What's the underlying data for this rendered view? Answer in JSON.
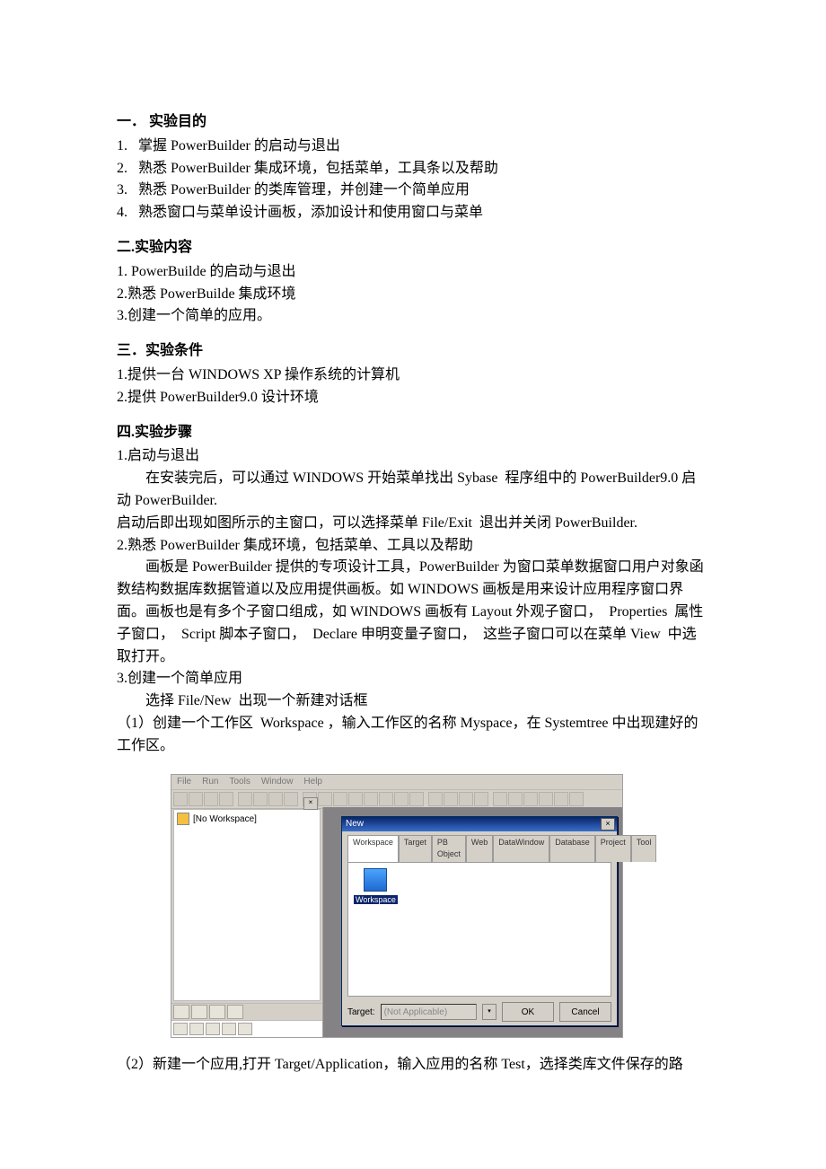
{
  "doc": {
    "s1": {
      "title": "一．   实验目的",
      "i1": "1.   掌握 PowerBuilder 的启动与退出",
      "i2": "2.   熟悉 PowerBuilder 集成环境，包括菜单，工具条以及帮助",
      "i3": "3.   熟悉 PowerBuilder 的类库管理，并创建一个简单应用",
      "i4": "4.   熟悉窗口与菜单设计画板，添加设计和使用窗口与菜单"
    },
    "s2": {
      "title": "二.实验内容",
      "i1": "1. PowerBuilde 的启动与退出",
      "i2": "2.熟悉 PowerBuilde 集成环境",
      "i3": "3.创建一个简单的应用。"
    },
    "s3": {
      "title": "三．实验条件",
      "i1": "1.提供一台 WINDOWS XP 操作系统的计算机",
      "i2": "2.提供 PowerBuilder9.0 设计环境"
    },
    "s4": {
      "title": "四.实验步骤",
      "p1": "1.启动与退出",
      "p2": "在安装完后，可以通过 WINDOWS 开始菜单找出 Sybase  程序组中的 PowerBuilder9.0 启动 PowerBuilder.",
      "p3": "启动后即出现如图所示的主窗口，可以选择菜单 File/Exit  退出并关闭 PowerBuilder.",
      "p4": "2.熟悉 PowerBuilder 集成环境，包括菜单、工具以及帮助",
      "p5": "画板是 PowerBuilder 提供的专项设计工具，PowerBuilder 为窗口菜单数据窗口用户对象函数结构数据库数据管道以及应用提供画板。如 WINDOWS 画板是用来设计应用程序窗口界面。画板也是有多个子窗口组成，如 WINDOWS 画板有 Layout 外观子窗口，  Properties  属性子窗口，  Script 脚本子窗口，  Declare 申明变量子窗口，  这些子窗口可以在菜单 View  中选取打开。",
      "p6": "3.创建一个简单应用",
      "p7": "选择 File/New  出现一个新建对话框",
      "p8": "（1）创建一个工作区  Workspace ，输入工作区的名称 Myspace，在 Systemtree 中出现建好的工作区。",
      "p9": "（2）新建一个应用,打开 Target/Application，输入应用的名称 Test，选择类库文件保存的路"
    }
  },
  "ui": {
    "menus": [
      "File",
      "Run",
      "Tools",
      "Window",
      "Help"
    ],
    "tree_label": "[No Workspace]",
    "dialog": {
      "title": "New",
      "tabs": [
        "Workspace",
        "Target",
        "PB Object",
        "Web",
        "DataWindow",
        "Database",
        "Project",
        "Tool"
      ],
      "ws_label": "Workspace",
      "target_label": "Target:",
      "target_value": "(Not Applicable)",
      "ok": "OK",
      "cancel": "Cancel"
    }
  }
}
